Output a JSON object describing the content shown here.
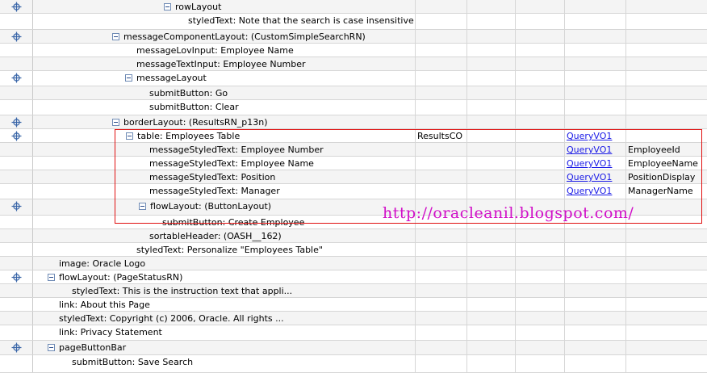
{
  "rows": [
    {
      "label": "rowLayout",
      "toggle": true,
      "target": true
    },
    {
      "label": "styledText: Note that the search is case insensitive",
      "toggle": false,
      "target": false
    },
    {
      "label": "messageComponentLayout: (CustomSimpleSearchRN)",
      "toggle": true,
      "target": true
    },
    {
      "label": "messageLovInput: Employee Name",
      "toggle": false,
      "target": false
    },
    {
      "label": "messageTextInput: Employee Number",
      "toggle": false,
      "target": false
    },
    {
      "label": "messageLayout",
      "toggle": true,
      "target": true
    },
    {
      "label": "submitButton: Go",
      "toggle": false,
      "target": false
    },
    {
      "label": "submitButton: Clear",
      "toggle": false,
      "target": false
    },
    {
      "label": "borderLayout: (ResultsRN_p13n)",
      "toggle": true,
      "target": true
    },
    {
      "label": "table: Employees Table",
      "toggle": true,
      "target": true,
      "controller": "ResultsCO",
      "vo": "QueryVO1"
    },
    {
      "label": "messageStyledText: Employee Number",
      "toggle": false,
      "target": false,
      "vo": "QueryVO1",
      "attr": "EmployeeId"
    },
    {
      "label": "messageStyledText: Employee Name",
      "toggle": false,
      "target": false,
      "vo": "QueryVO1",
      "attr": "EmployeeName"
    },
    {
      "label": "messageStyledText: Position",
      "toggle": false,
      "target": false,
      "vo": "QueryVO1",
      "attr": "PositionDisplay"
    },
    {
      "label": "messageStyledText: Manager",
      "toggle": false,
      "target": false,
      "vo": "QueryVO1",
      "attr": "ManagerName"
    },
    {
      "label": "flowLayout: (ButtonLayout)",
      "toggle": true,
      "target": true
    },
    {
      "label": "submitButton: Create Employee",
      "toggle": false,
      "target": false
    },
    {
      "label": "sortableHeader: (OASH__162)",
      "toggle": false,
      "target": false
    },
    {
      "label": "styledText: Personalize \"Employees Table\"",
      "toggle": false,
      "target": false
    },
    {
      "label": "image: Oracle Logo",
      "toggle": false,
      "target": false
    },
    {
      "label": "flowLayout: (PageStatusRN)",
      "toggle": true,
      "target": true
    },
    {
      "label": "styledText: This is the instruction text that appli...",
      "toggle": false,
      "target": false
    },
    {
      "label": "link: About this Page",
      "toggle": false,
      "target": false
    },
    {
      "label": "styledText: Copyright (c) 2006, Oracle. All rights ...",
      "toggle": false,
      "target": false
    },
    {
      "label": "link: Privacy Statement",
      "toggle": false,
      "target": false
    },
    {
      "label": "pageButtonBar",
      "toggle": true,
      "target": true
    },
    {
      "label": "submitButton: Save Search",
      "toggle": false,
      "target": false
    }
  ],
  "watermark": "http://oracleanil.blogspot.com/",
  "colors": {
    "highlight_border": "#e01010",
    "watermark": "#d10fc8",
    "link": "#1a1ae6"
  }
}
